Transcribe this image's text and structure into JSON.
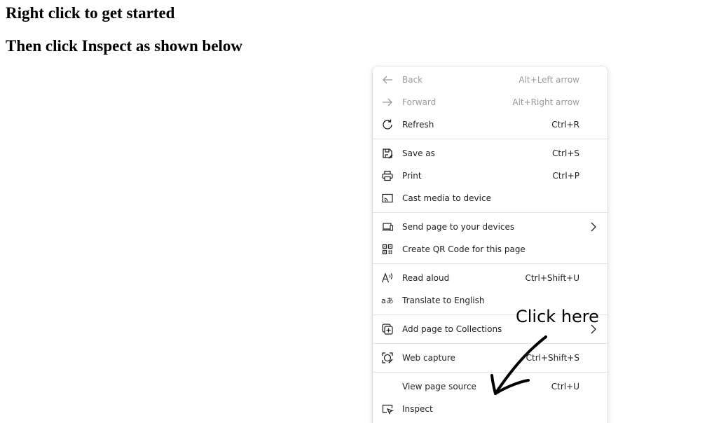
{
  "page": {
    "heading_1": "Right click to get started",
    "heading_2": "Then click Inspect as shown below"
  },
  "context_menu": {
    "items": [
      {
        "label": "Back",
        "shortcut": "Alt+Left arrow",
        "icon": "arrow-left-icon",
        "disabled": true
      },
      {
        "label": "Forward",
        "shortcut": "Alt+Right arrow",
        "icon": "arrow-right-icon",
        "disabled": true
      },
      {
        "label": "Refresh",
        "shortcut": "Ctrl+R",
        "icon": "refresh-icon"
      },
      {
        "label": "Save as",
        "shortcut": "Ctrl+S",
        "icon": "save-as-icon"
      },
      {
        "label": "Print",
        "shortcut": "Ctrl+P",
        "icon": "printer-icon"
      },
      {
        "label": "Cast media to device",
        "shortcut": "",
        "icon": "cast-icon"
      },
      {
        "label": "Send page to your devices",
        "shortcut": "",
        "icon": "devices-icon",
        "submenu": true
      },
      {
        "label": "Create QR Code for this page",
        "shortcut": "",
        "icon": "qr-code-icon"
      },
      {
        "label": "Read aloud",
        "shortcut": "Ctrl+Shift+U",
        "icon": "read-aloud-icon"
      },
      {
        "label": "Translate to English",
        "shortcut": "",
        "icon": "translate-icon"
      },
      {
        "label": "Add page to Collections",
        "shortcut": "",
        "icon": "collections-icon",
        "submenu": true
      },
      {
        "label": "Web capture",
        "shortcut": "Ctrl+Shift+S",
        "icon": "web-capture-icon"
      },
      {
        "label": "View page source",
        "shortcut": "Ctrl+U",
        "icon": ""
      },
      {
        "label": "Inspect",
        "shortcut": "",
        "icon": "inspect-icon"
      }
    ]
  },
  "annotation": {
    "text": "Click here",
    "icon": "hand-drawn-arrow-icon"
  },
  "colors": {
    "menu_background": "#ffffff",
    "disabled_text": "#9a9a9a",
    "separator": "#e2e2e2"
  }
}
